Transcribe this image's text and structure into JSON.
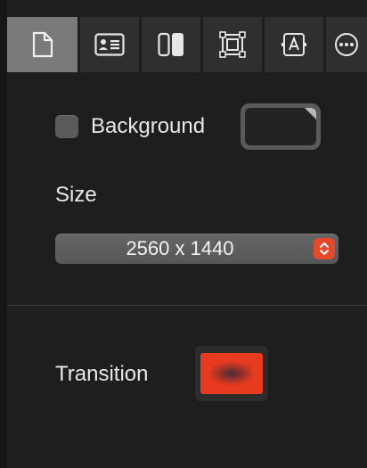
{
  "toolbar": {
    "tabs": [
      {
        "name": "document",
        "icon": "document-icon",
        "active": true
      },
      {
        "name": "slide-layout",
        "icon": "id-card-icon",
        "active": false
      },
      {
        "name": "split-view",
        "icon": "split-panels-icon",
        "active": false
      },
      {
        "name": "arrange",
        "icon": "arrange-frame-icon",
        "active": false
      },
      {
        "name": "text-format",
        "icon": "text-frame-icon",
        "active": false
      },
      {
        "name": "more",
        "icon": "ellipsis-circle-icon",
        "active": false
      }
    ]
  },
  "background": {
    "label": "Background",
    "checked": false,
    "well_color": "#232323"
  },
  "size": {
    "label": "Size",
    "value": "2560 x 1440"
  },
  "transition": {
    "label": "Transition",
    "swatch_colors": [
      "#e83a1e",
      "#4a2a3a"
    ]
  },
  "colors": {
    "accent": "#e8482a",
    "panel_bg": "#1e1e1e",
    "active_tab": "#7a7a7a",
    "tab_bg": "#2f2f2f"
  }
}
